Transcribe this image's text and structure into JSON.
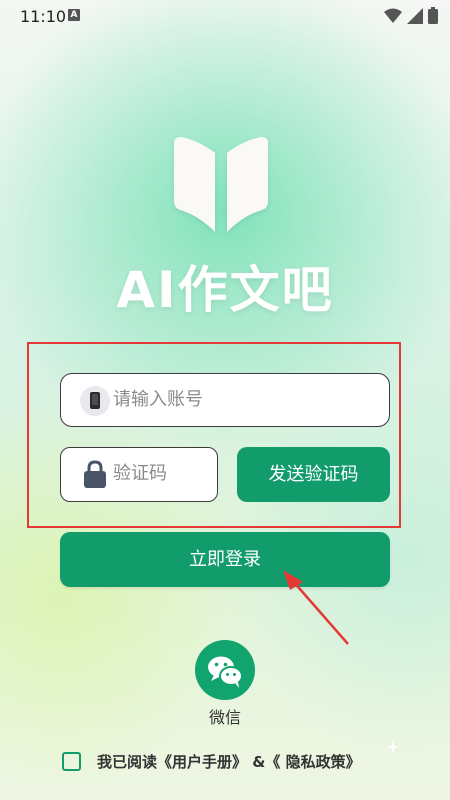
{
  "status_bar": {
    "time": "11:10",
    "notification_icon": "android-a-icon",
    "icons": [
      "wifi-icon",
      "signal-icon",
      "battery-icon"
    ]
  },
  "brand": {
    "app_name": "AI作文吧",
    "logo_icon": "open-book-icon"
  },
  "login_form": {
    "account_placeholder": "请输入账号",
    "code_placeholder": "验证码",
    "send_code_label": "发送验证码",
    "login_label": "立即登录"
  },
  "social_login": {
    "wechat_label": "微信"
  },
  "agreement": {
    "prefix": "我已阅读",
    "user_manual": "《用户手册》",
    "connector": " &",
    "privacy_policy": "《 隐私政策》"
  },
  "colors": {
    "primary": "#129c6b",
    "annotation_red": "#e53935"
  }
}
